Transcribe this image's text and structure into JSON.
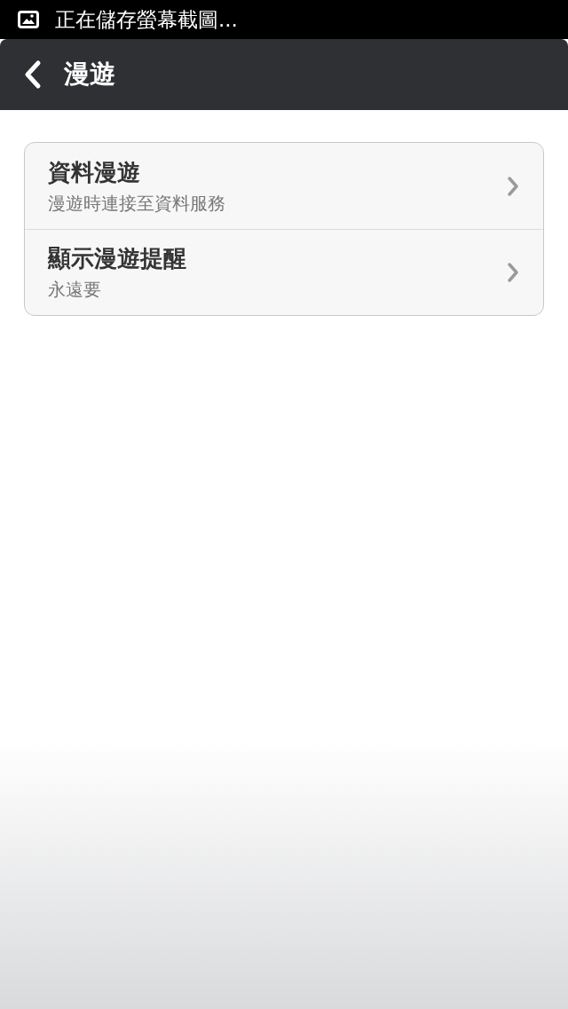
{
  "status_bar": {
    "notification": "正在儲存螢幕截圖..."
  },
  "header": {
    "title": "漫遊"
  },
  "settings": [
    {
      "title": "資料漫遊",
      "subtitle": "漫遊時連接至資料服務"
    },
    {
      "title": "顯示漫遊提醒",
      "subtitle": "永遠要"
    }
  ]
}
